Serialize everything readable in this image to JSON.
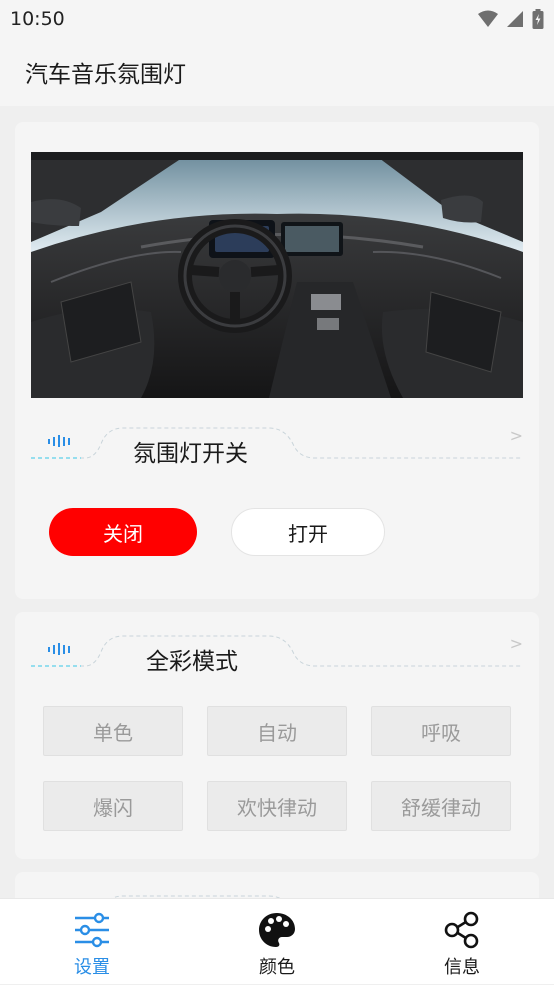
{
  "status_bar": {
    "time": "10:50"
  },
  "app_bar": {
    "title": "汽车音乐氛围灯"
  },
  "power_section": {
    "title": "氛围灯开关",
    "arrow": ">",
    "off_label": "关闭",
    "on_label": "打开",
    "selected": "关闭"
  },
  "mode_section": {
    "title": "全彩模式",
    "arrow": ">",
    "modes": [
      "单色",
      "自动",
      "呼吸",
      "爆闪",
      "欢快律动",
      "舒缓律动"
    ]
  },
  "bottom_nav": {
    "items": [
      {
        "label": "设置",
        "icon": "settings-sliders-icon",
        "active": true
      },
      {
        "label": "颜色",
        "icon": "palette-icon",
        "active": false
      },
      {
        "label": "信息",
        "icon": "share-nodes-icon",
        "active": false
      }
    ]
  },
  "colors": {
    "accent_blue": "#2a8ee6",
    "off_red": "#ff0000",
    "background": "#efefef",
    "card": "#f5f5f5"
  }
}
